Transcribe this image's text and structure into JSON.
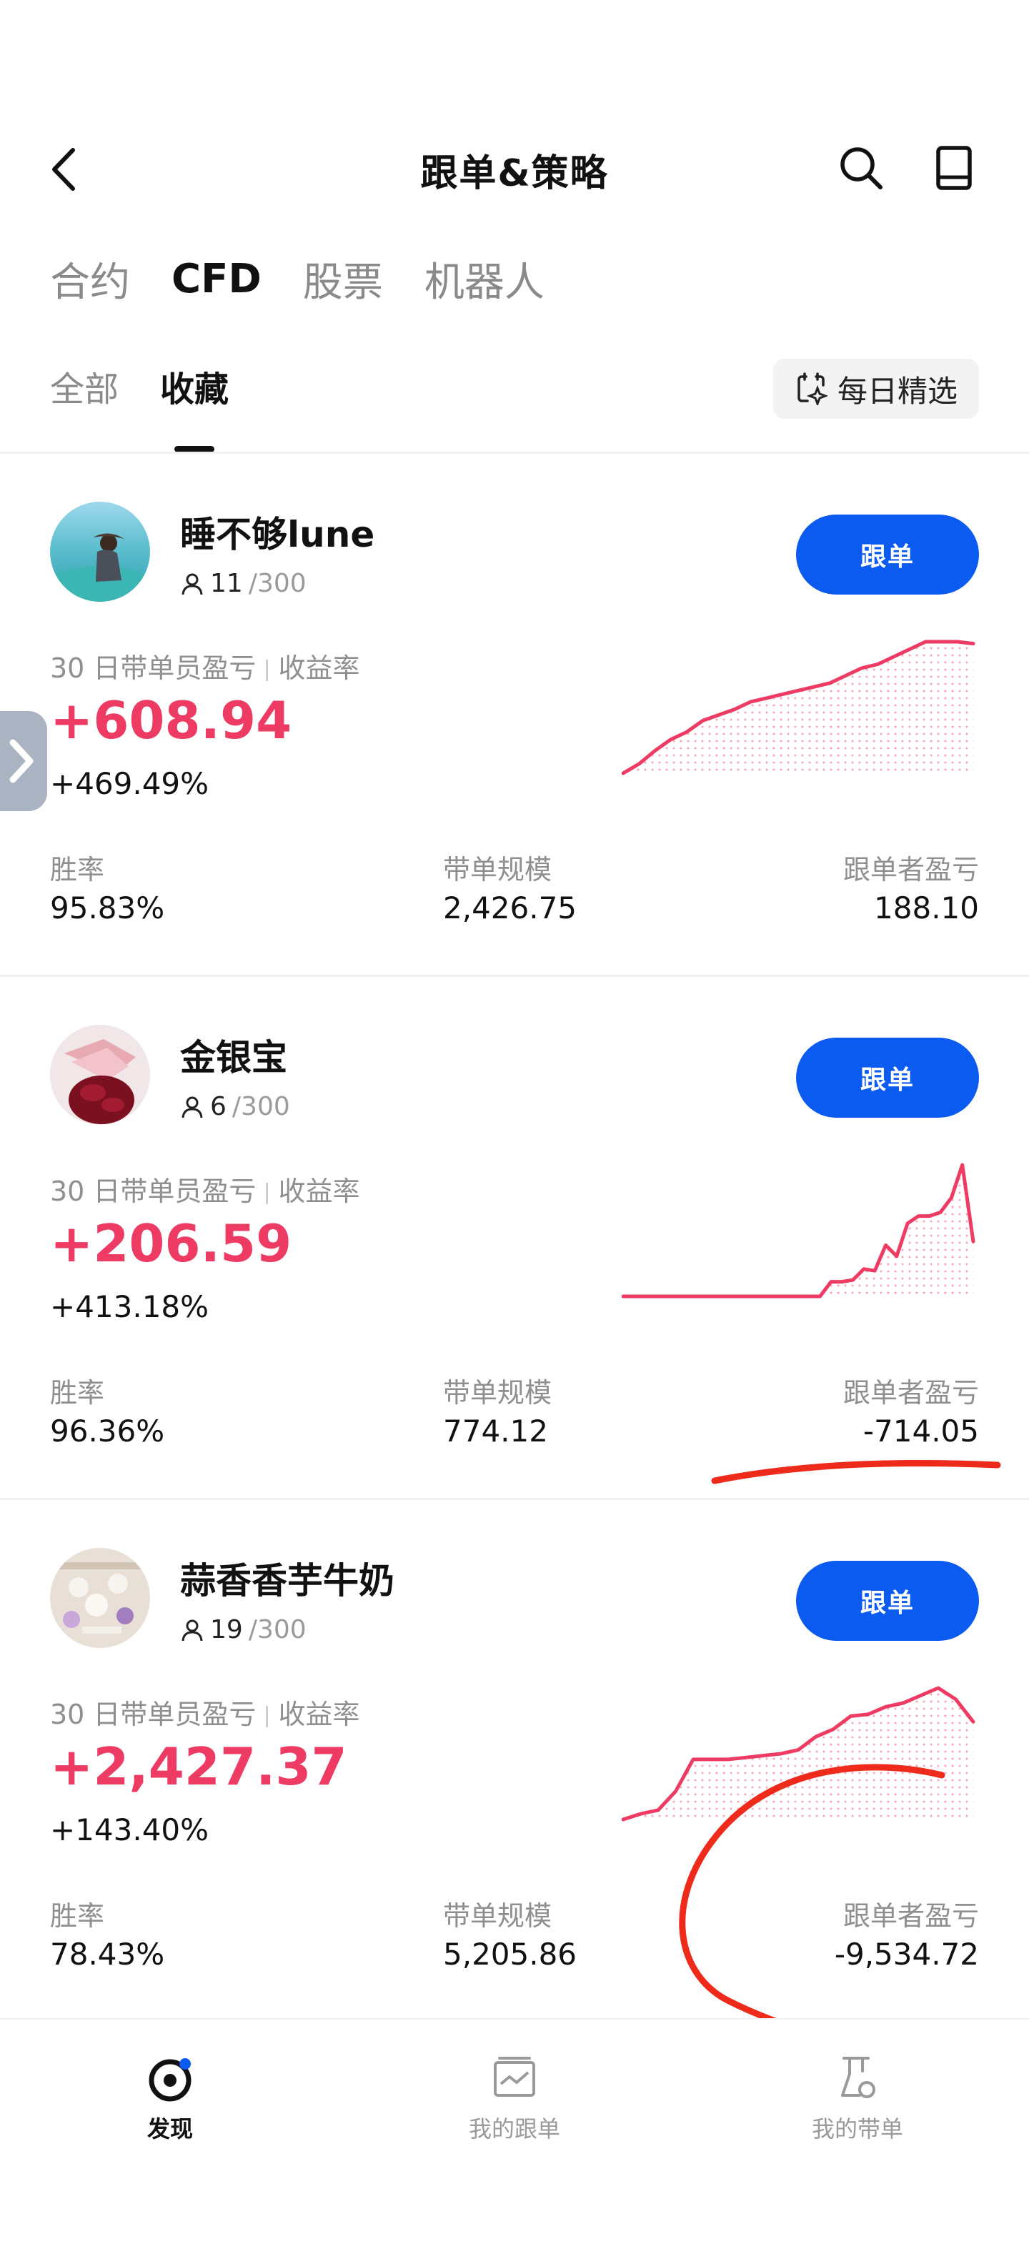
{
  "header": {
    "title": "跟单&策略"
  },
  "tabs": [
    {
      "label": "合约",
      "active": false
    },
    {
      "label": "CFD",
      "active": true
    },
    {
      "label": "股票",
      "active": false
    },
    {
      "label": "机器人",
      "active": false
    }
  ],
  "subtabs": [
    {
      "label": "全部",
      "active": false
    },
    {
      "label": "收藏",
      "active": true
    }
  ],
  "daily_pick": {
    "label": "每日精选"
  },
  "common": {
    "follow_label": "跟单",
    "metric_label_a": "30 日带单员盈亏",
    "metric_label_b": "收益率",
    "win_rate_label": "胜率",
    "scale_label": "带单规模",
    "follower_pnl_label": "跟单者盈亏",
    "capacity": "/300"
  },
  "traders": [
    {
      "name": "睡不够lune",
      "followers": "11",
      "pnl": "+608.94",
      "return_rate": "+469.49%",
      "win_rate": "95.83%",
      "scale": "2,426.75",
      "follower_pnl": "188.10",
      "trend": [
        0,
        5,
        12,
        18,
        22,
        28,
        31,
        34,
        38,
        40,
        42,
        44,
        46,
        48,
        52,
        56,
        58,
        62,
        66,
        70,
        70,
        70,
        69
      ]
    },
    {
      "name": "金银宝",
      "followers": "6",
      "pnl": "+206.59",
      "return_rate": "+413.18%",
      "win_rate": "96.36%",
      "scale": "774.12",
      "follower_pnl": "-714.05",
      "trend": [
        0,
        0,
        0,
        0,
        0,
        0,
        0,
        0,
        0,
        0,
        0,
        0,
        0,
        0,
        0,
        0,
        0,
        0,
        0,
        8,
        8,
        9,
        15,
        14,
        28,
        22,
        40,
        44,
        44,
        46,
        54,
        72,
        30
      ]
    },
    {
      "name": "蒜香香芋牛奶",
      "followers": "19",
      "pnl": "+2,427.37",
      "return_rate": "+143.40%",
      "win_rate": "78.43%",
      "scale": "5,205.86",
      "follower_pnl": "-9,534.72",
      "trend": [
        0,
        3,
        5,
        15,
        32,
        32,
        32,
        33,
        34,
        35,
        37,
        44,
        48,
        55,
        56,
        60,
        62,
        66,
        70,
        64,
        52
      ]
    }
  ],
  "bottom_nav": [
    {
      "label": "发现",
      "icon": "discover-icon",
      "active": true
    },
    {
      "label": "我的跟单",
      "icon": "chart-board-icon",
      "active": false
    },
    {
      "label": "我的带单",
      "icon": "flask-icon",
      "active": false
    }
  ],
  "colors": {
    "accent": "#0b5bf0",
    "profit": "#ee3b63",
    "annotation": "#ee2a1a"
  }
}
